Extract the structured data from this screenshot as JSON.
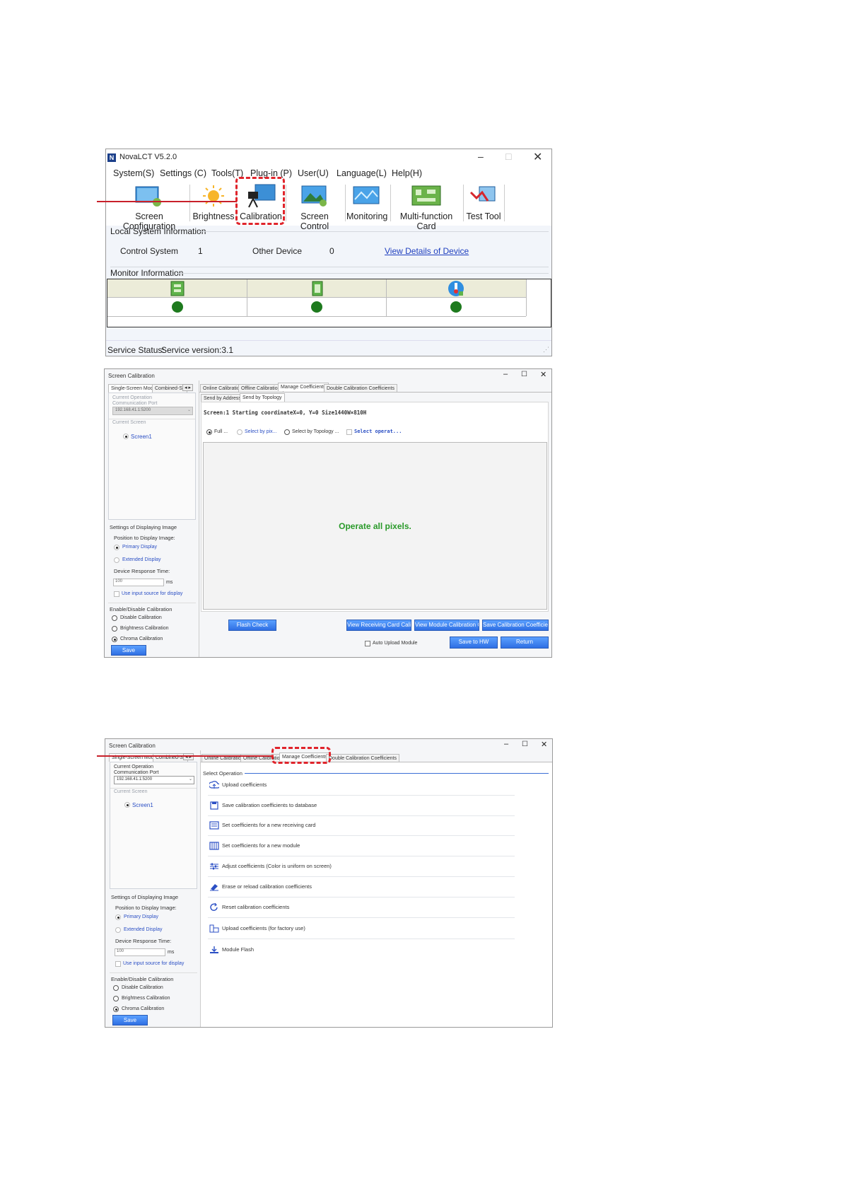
{
  "win1": {
    "title": "NovaLCT V5.2.0",
    "menu": [
      "System(S)",
      "Settings (C)",
      "Tools(T)",
      "Plug-in (P)",
      "User(U)",
      "Language(L)",
      "Help(H)"
    ],
    "toolbar": [
      "Screen Configuration",
      "Brightness",
      "Calibration",
      "Screen Control",
      "Monitoring",
      "Multi-function Card",
      "Test Tool"
    ],
    "local_section": "Local System Information",
    "control_system_label": "Control System",
    "control_system_value": "1",
    "other_device_label": "Other Device",
    "other_device_value": "0",
    "view_details_link": "View Details of Device",
    "monitor_section": "Monitor Information",
    "status_label": "Service Status:",
    "service_version": "Service version:3.1",
    "colors": {
      "status_ok": "#1e7a1e",
      "link": "#1f3fbf",
      "accent_red": "#e0242b"
    }
  },
  "win2": {
    "title": "Screen Calibration",
    "left_tabs": [
      "Single-Screen Mode",
      "Combined-Sc"
    ],
    "current_operation": "Current Operation",
    "communication_port": "Communication Port",
    "port_value": "192.168.41.1:5200",
    "current_screen": "Current Screen",
    "screen_item": "Screen1",
    "settings_display": "Settings of Displaying Image",
    "position_label": "Position to Display Image:",
    "primary_display": "Primary Display",
    "extended_display": "Extended Display",
    "response_label": "Device Response Time:",
    "response_value": "100",
    "response_unit": "ms",
    "use_input": "Use input source for display",
    "enable_disable": "Enable/Disable Calibration",
    "disable_cal": "Disable Calibration",
    "brightness_cal": "Brightness Calibration",
    "chroma_cal": "Chroma Calibration",
    "save": "Save",
    "top_tabs": [
      "Online Calibration",
      "Offline Calibration",
      "Manage Coefficients",
      "Double Calibration Coefficients"
    ],
    "sub_tabs": [
      "Send by Address",
      "Send by Topology"
    ],
    "info_line": "Screen:1  Starting coordinateX=0, Y=0   Size1440W×810H",
    "radios": [
      "Full ...",
      "Select by pix...",
      "Select by Topology ...",
      "Select operat..."
    ],
    "operate_msg": "Operate all pixels.",
    "flash_check": "Flash Check",
    "view_receiving": "View Receiving Card Calibr...",
    "view_module": "View Module Calibration C...",
    "save_coeff": "Save Calibration Coefficien...",
    "auto_upload": "Auto Upload Module",
    "save_to_hw": "Save to HW",
    "return": "Return"
  },
  "win3": {
    "title": "Screen Calibration",
    "left_tabs": [
      "Single-Screen Mode",
      "Combined-Sc"
    ],
    "current_operation": "Current Operation",
    "communication_port": "Communication Port",
    "port_value": "192.168.41.1:5200",
    "current_screen": "Current Screen",
    "screen_item": "Screen1",
    "settings_display": "Settings of Displaying Image",
    "position_label": "Position to Display Image:",
    "primary_display": "Primary Display",
    "extended_display": "Extended Display",
    "response_label": "Device Response Time:",
    "response_value": "100",
    "response_unit": "ms",
    "use_input": "Use input source for display",
    "enable_disable": "Enable/Disable Calibration",
    "disable_cal": "Disable Calibration",
    "brightness_cal": "Brightness Calibration",
    "chroma_cal": "Chroma Calibration",
    "save": "Save",
    "top_tabs": [
      "Online Calibration",
      "Offline Calibration",
      "Manage Coefficients",
      "Double Calibration Coefficients"
    ],
    "select_operation": "Select Operation",
    "operations": [
      {
        "label": "Upload coefficients",
        "icon": "upload-cloud-icon"
      },
      {
        "label": "Save calibration coefficients to database",
        "icon": "save-disk-icon"
      },
      {
        "label": "Set coefficients for a new receiving card",
        "icon": "receiving-card-icon"
      },
      {
        "label": "Set coefficients for a new module",
        "icon": "module-grid-icon"
      },
      {
        "label": "Adjust coefficients (Color is uniform on screen)",
        "icon": "sliders-icon"
      },
      {
        "label": "Erase or reload calibration coefficients",
        "icon": "eraser-icon"
      },
      {
        "label": "Reset calibration coefficients",
        "icon": "reset-icon"
      },
      {
        "label": "Upload coefficients (for factory use)",
        "icon": "factory-upload-icon"
      },
      {
        "label": "Module Flash",
        "icon": "download-icon"
      }
    ]
  }
}
